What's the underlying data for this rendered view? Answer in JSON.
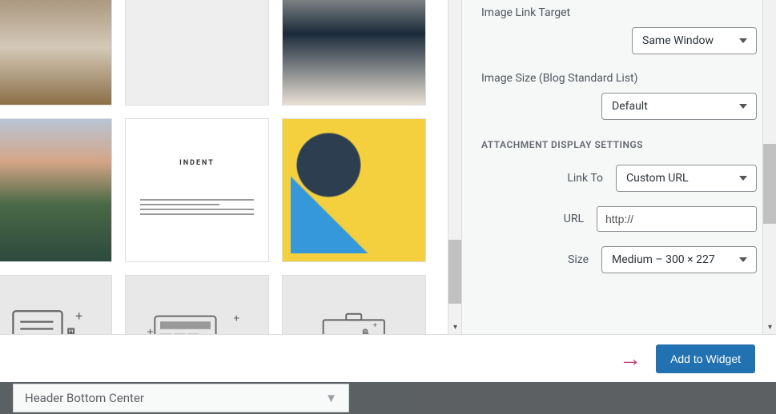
{
  "settings": {
    "image_link_target": {
      "label": "Image Link Target",
      "value": "Same Window"
    },
    "image_size_blog": {
      "label": "Image Size (Blog Standard List)",
      "value": "Default"
    }
  },
  "attachment": {
    "section_title": "ATTACHMENT DISPLAY SETTINGS",
    "link_to": {
      "label": "Link To",
      "value": "Custom URL"
    },
    "url": {
      "label": "URL",
      "value": "http://"
    },
    "size": {
      "label": "Size",
      "value": "Medium – 300 × 227"
    }
  },
  "footer": {
    "primary_button": "Add to Widget"
  },
  "backdrop": {
    "accordion_title": "Header Bottom Center"
  },
  "thumbnails": [
    {
      "name": "sepia-architecture"
    },
    {
      "name": "blank-gray"
    },
    {
      "name": "fashion-dress"
    },
    {
      "name": "mountain-landscape"
    },
    {
      "name": "indent-website",
      "text": "INDENT"
    },
    {
      "name": "abstract-art"
    },
    {
      "name": "wireframe-documents"
    },
    {
      "name": "wireframe-devices"
    },
    {
      "name": "wireframe-presentation"
    }
  ]
}
